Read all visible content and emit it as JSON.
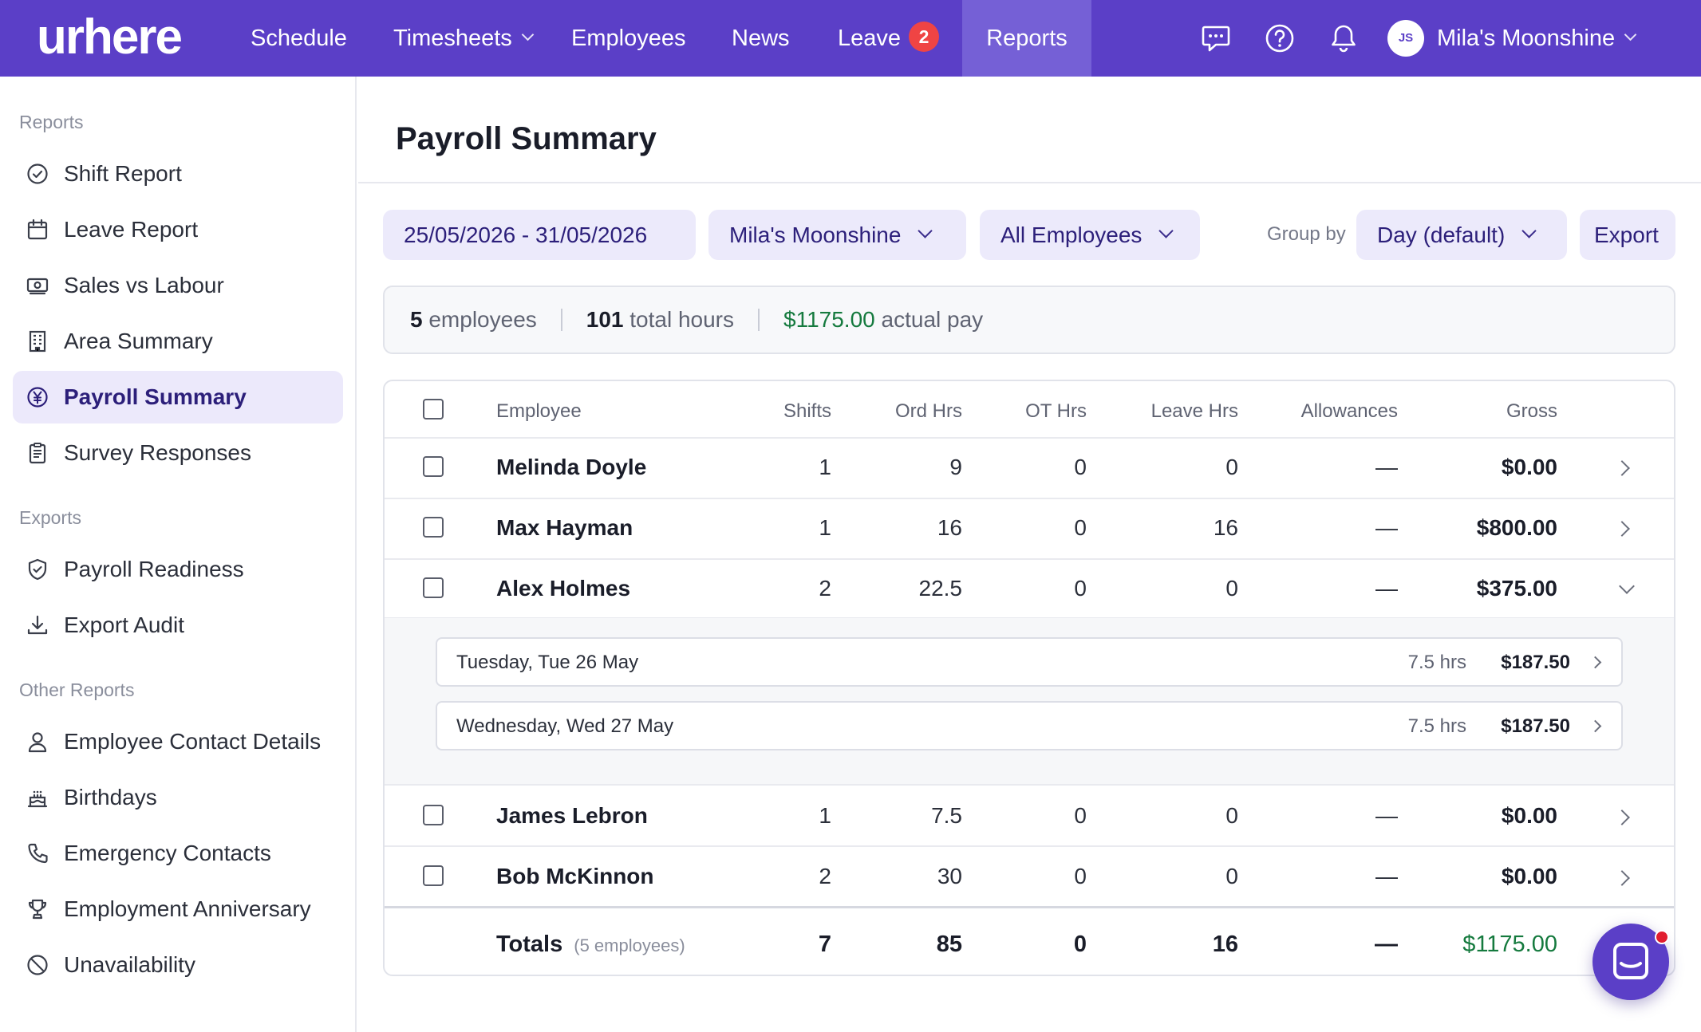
{
  "app": {
    "logo": "urhere"
  },
  "nav": {
    "schedule": "Schedule",
    "timesheets": "Timesheets",
    "employees": "Employees",
    "news": "News",
    "leave": "Leave",
    "leave_badge": "2",
    "reports": "Reports"
  },
  "account": {
    "initials": "JS",
    "name": "Mila's Moonshine"
  },
  "sidebar": {
    "reports_title": "Reports",
    "exports_title": "Exports",
    "other_title": "Other Reports",
    "items": [
      {
        "label": "Shift Report",
        "icon": "check-circle-icon"
      },
      {
        "label": "Leave Report",
        "icon": "calendar-icon"
      },
      {
        "label": "Sales vs Labour",
        "icon": "cash-icon"
      },
      {
        "label": "Area Summary",
        "icon": "building-icon"
      },
      {
        "label": "Payroll Summary",
        "icon": "currency-circle-icon"
      },
      {
        "label": "Survey Responses",
        "icon": "clipboard-icon"
      },
      {
        "label": "Payroll Readiness",
        "icon": "shield-check-icon"
      },
      {
        "label": "Export Audit",
        "icon": "download-icon"
      },
      {
        "label": "Employee Contact Details",
        "icon": "person-icon"
      },
      {
        "label": "Birthdays",
        "icon": "cake-icon"
      },
      {
        "label": "Emergency Contacts",
        "icon": "phone-icon"
      },
      {
        "label": "Employment Anniversary",
        "icon": "trophy-icon"
      },
      {
        "label": "Unavailability",
        "icon": "ban-icon"
      }
    ]
  },
  "page": {
    "title": "Payroll Summary"
  },
  "filters": {
    "date_range": "25/05/2026 - 31/05/2026",
    "location": "Mila's Moonshine",
    "employees": "All Employees",
    "group_by_label": "Group by",
    "group_by": "Day (default)",
    "export": "Export"
  },
  "stats": {
    "employees_count": "5",
    "employees_label": "employees",
    "hours": "101",
    "hours_label": "total hours",
    "pay": "$1175.00",
    "pay_label": "actual pay"
  },
  "table": {
    "headers": [
      "Employee",
      "Shifts",
      "Ord Hrs",
      "OT Hrs",
      "Leave Hrs",
      "Allowances",
      "Gross"
    ],
    "rows": [
      {
        "name": "Melinda Doyle",
        "shifts": "1",
        "ord": "9",
        "ot": "0",
        "leave": "0",
        "allow": "—",
        "gross": "$0.00"
      },
      {
        "name": "Max Hayman",
        "shifts": "1",
        "ord": "16",
        "ot": "0",
        "leave": "16",
        "allow": "—",
        "gross": "$800.00"
      },
      {
        "name": "Alex Holmes",
        "shifts": "2",
        "ord": "22.5",
        "ot": "0",
        "leave": "0",
        "allow": "—",
        "gross": "$375.00"
      },
      {
        "name": "James Lebron",
        "shifts": "1",
        "ord": "7.5",
        "ot": "0",
        "leave": "0",
        "allow": "—",
        "gross": "$0.00"
      },
      {
        "name": "Bob McKinnon",
        "shifts": "2",
        "ord": "30",
        "ot": "0",
        "leave": "0",
        "allow": "—",
        "gross": "$0.00"
      }
    ],
    "expanded_days": [
      {
        "label": "Tuesday, Tue 26 May",
        "hrs": "7.5 hrs",
        "amount": "$187.50"
      },
      {
        "label": "Wednesday, Wed 27 May",
        "hrs": "7.5 hrs",
        "amount": "$187.50"
      }
    ],
    "totals": {
      "label": "Totals",
      "sub": "(5 employees)",
      "shifts": "7",
      "ord": "85",
      "ot": "0",
      "leave": "16",
      "allow": "—",
      "gross": "$1175.00"
    }
  },
  "colors": {
    "brand": "#5b3fc7",
    "positive": "#157a3e",
    "badge": "#ef4444"
  }
}
